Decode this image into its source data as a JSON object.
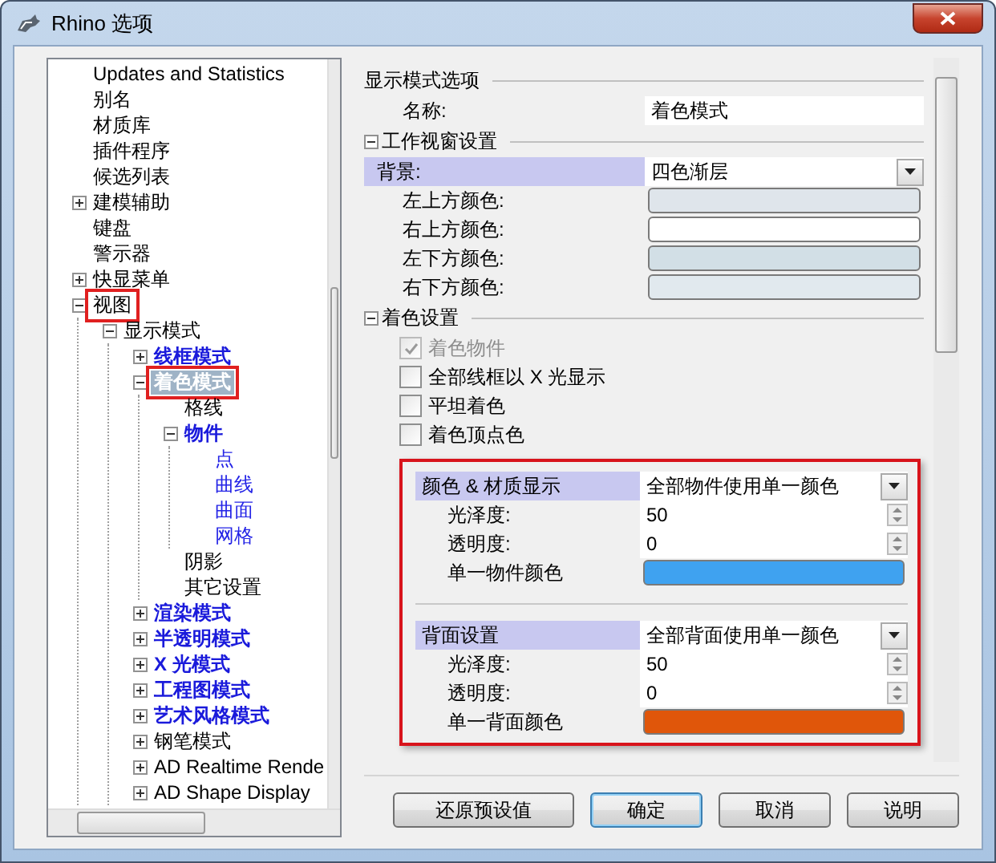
{
  "window": {
    "title": "Rhino 选项"
  },
  "tree": [
    {
      "label": "Updates and Statistics",
      "kind": "plain",
      "selected": false,
      "highlighted": false
    },
    {
      "label": "别名",
      "kind": "plain",
      "selected": false,
      "highlighted": false
    },
    {
      "label": "材质库",
      "kind": "plain",
      "selected": false,
      "highlighted": false
    },
    {
      "label": "插件程序",
      "kind": "plain",
      "selected": false,
      "highlighted": false
    },
    {
      "label": "候选列表",
      "kind": "plain",
      "selected": false,
      "highlighted": false
    },
    {
      "label": "建模辅助",
      "kind": "plain",
      "selected": false,
      "highlighted": false,
      "expanded": false
    },
    {
      "label": "键盘",
      "kind": "plain",
      "selected": false,
      "highlighted": false
    },
    {
      "label": "警示器",
      "kind": "plain",
      "selected": false,
      "highlighted": false
    },
    {
      "label": "快显菜单",
      "kind": "plain",
      "selected": false,
      "highlighted": false,
      "expanded": false
    },
    {
      "label": "视图",
      "kind": "plain",
      "selected": false,
      "highlighted": true,
      "expanded": true,
      "children": [
        {
          "label": "显示模式",
          "kind": "plain",
          "selected": false,
          "highlighted": false,
          "expanded": true,
          "children": [
            {
              "label": "线框模式",
              "kind": "custom",
              "selected": false,
              "highlighted": false,
              "expanded": false
            },
            {
              "label": "着色模式",
              "kind": "custom",
              "selected": true,
              "highlighted": true,
              "expanded": true,
              "children": [
                {
                  "label": "格线",
                  "kind": "plain",
                  "selected": false,
                  "highlighted": false
                },
                {
                  "label": "物件",
                  "kind": "custom",
                  "selected": false,
                  "highlighted": false,
                  "expanded": true,
                  "children": [
                    {
                      "label": "点",
                      "kind": "link",
                      "selected": false,
                      "highlighted": false
                    },
                    {
                      "label": "曲线",
                      "kind": "link",
                      "selected": false,
                      "highlighted": false
                    },
                    {
                      "label": "曲面",
                      "kind": "link",
                      "selected": false,
                      "highlighted": false
                    },
                    {
                      "label": "网格",
                      "kind": "link",
                      "selected": false,
                      "highlighted": false
                    }
                  ]
                },
                {
                  "label": "阴影",
                  "kind": "plain",
                  "selected": false,
                  "highlighted": false
                },
                {
                  "label": "其它设置",
                  "kind": "plain",
                  "selected": false,
                  "highlighted": false
                }
              ]
            },
            {
              "label": "渲染模式",
              "kind": "custom",
              "selected": false,
              "highlighted": false,
              "expanded": false
            },
            {
              "label": "半透明模式",
              "kind": "custom",
              "selected": false,
              "highlighted": false,
              "expanded": false
            },
            {
              "label": "X 光模式",
              "kind": "custom",
              "selected": false,
              "highlighted": false,
              "expanded": false
            },
            {
              "label": "工程图模式",
              "kind": "custom",
              "selected": false,
              "highlighted": false,
              "expanded": false
            },
            {
              "label": "艺术风格模式",
              "kind": "custom",
              "selected": false,
              "highlighted": false,
              "expanded": false
            },
            {
              "label": "钢笔模式",
              "kind": "plain",
              "selected": false,
              "highlighted": false,
              "expanded": false
            },
            {
              "label": "AD Realtime Rende",
              "kind": "plain",
              "selected": false,
              "highlighted": false,
              "expanded": false
            },
            {
              "label": "AD Shape Display",
              "kind": "plain",
              "selected": false,
              "highlighted": false,
              "expanded": false
            }
          ]
        }
      ]
    }
  ],
  "panel": {
    "sections": [
      {
        "title": "显示模式选项",
        "rows": [
          {
            "kind": "text",
            "label": "名称:",
            "value": "着色模式"
          }
        ]
      },
      {
        "title": "工作视窗设置",
        "expanded": true,
        "rows": [
          {
            "kind": "heading",
            "label": "背景:",
            "value": "四色渐层"
          },
          {
            "kind": "color",
            "label": "左上方颜色:",
            "color": "#dfe5eb"
          },
          {
            "kind": "color",
            "label": "右上方颜色:",
            "color": "#ffffff"
          },
          {
            "kind": "color",
            "label": "左下方颜色:",
            "color": "#d2dfe6"
          },
          {
            "kind": "color",
            "label": "右下方颜色:",
            "color": "#e1e9ee"
          }
        ]
      },
      {
        "title": "着色设置",
        "expanded": true,
        "rows": [
          {
            "kind": "checkbox",
            "label": "着色物件",
            "checked": true,
            "disabled": true
          },
          {
            "kind": "checkbox",
            "label": "全部线框以 X 光显示",
            "checked": false,
            "disabled": false
          },
          {
            "kind": "checkbox",
            "label": "平坦着色",
            "checked": false,
            "disabled": false
          },
          {
            "kind": "checkbox",
            "label": "着色顶点色",
            "checked": false,
            "disabled": false
          }
        ]
      }
    ],
    "callout": {
      "groups": [
        {
          "rows": [
            {
              "kind": "heading",
              "label": "颜色 & 材质显示",
              "value": "全部物件使用单一颜色"
            },
            {
              "kind": "spinner",
              "label": "光泽度:",
              "value": "50"
            },
            {
              "kind": "spinner",
              "label": "透明度:",
              "value": "0"
            },
            {
              "kind": "color",
              "label": "单一物件颜色",
              "color": "#3fa2f0"
            }
          ]
        },
        {
          "rows": [
            {
              "kind": "heading",
              "label": "背面设置",
              "value": "全部背面使用单一颜色"
            },
            {
              "kind": "spinner",
              "label": "光泽度:",
              "value": "50"
            },
            {
              "kind": "spinner",
              "label": "透明度:",
              "value": "0"
            },
            {
              "kind": "color",
              "label": "单一背面颜色",
              "color": "#e0560a"
            }
          ]
        }
      ]
    }
  },
  "buttons": [
    {
      "label": "还原预设值",
      "default": false
    },
    {
      "label": "确定",
      "default": true
    },
    {
      "label": "取消",
      "default": false
    },
    {
      "label": "说明",
      "default": false
    }
  ]
}
